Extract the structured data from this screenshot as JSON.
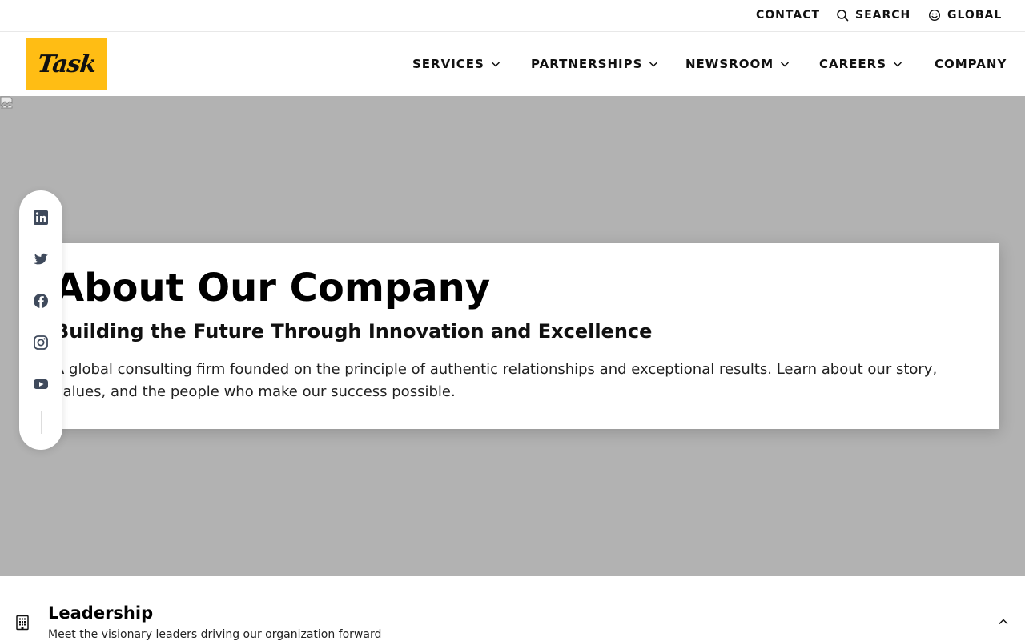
{
  "utility_bar": {
    "contact_label": "CONTACT",
    "search_label": "SEARCH",
    "global_label": "GLOBAL"
  },
  "header": {
    "logo_text": "Task",
    "nav": [
      {
        "label": "SERVICES",
        "has_dropdown": true
      },
      {
        "label": "PARTNERSHIPS",
        "has_dropdown": true
      },
      {
        "label": "NEWSROOM",
        "has_dropdown": true
      },
      {
        "label": "CAREERS",
        "has_dropdown": true
      },
      {
        "label": "COMPANY",
        "has_dropdown": false
      }
    ]
  },
  "hero": {
    "title": "About Our Company",
    "subtitle": "Building the Future Through Innovation and Excellence",
    "description": "A global consulting firm founded on the principle of authentic relationships and exceptional results. Learn about our story, values, and the people who make our success possible."
  },
  "social": {
    "icons": [
      "linkedin-icon",
      "twitter-icon",
      "facebook-icon",
      "instagram-icon",
      "youtube-icon"
    ]
  },
  "accordion": {
    "title": "Leadership",
    "description": "Meet the visionary leaders driving our organization forward",
    "icon": "building-icon",
    "toggle_icon": "chevron-up-icon"
  },
  "colors": {
    "brand_yellow": "#ffbd14",
    "hero_background": "#b2b2b2",
    "text_primary": "#111111"
  }
}
